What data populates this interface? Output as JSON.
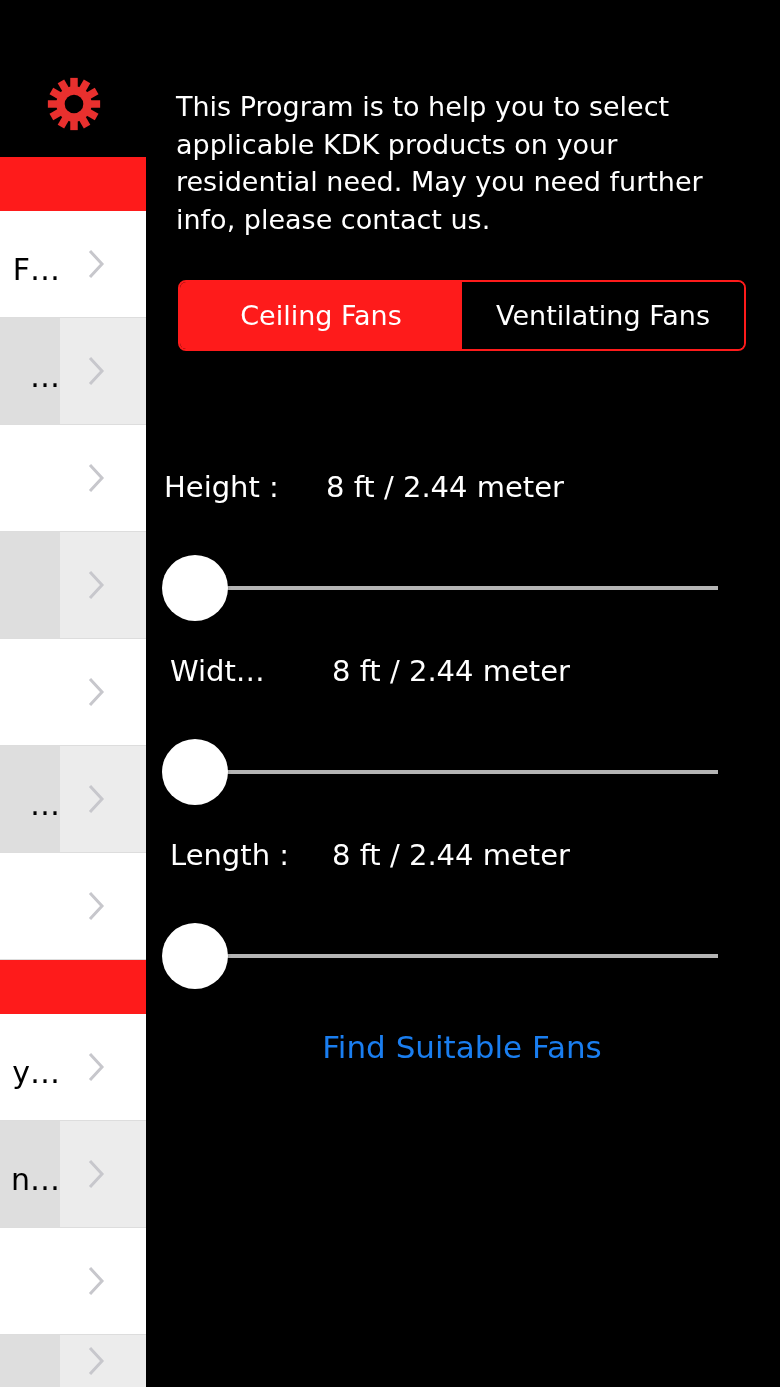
{
  "menu": {
    "items": [
      {
        "kind": "header"
      },
      {
        "kind": "row",
        "label": "F…"
      },
      {
        "kind": "row",
        "label": "…"
      },
      {
        "kind": "row"
      },
      {
        "kind": "row"
      },
      {
        "kind": "row"
      },
      {
        "kind": "row",
        "label": "…"
      },
      {
        "kind": "row"
      },
      {
        "kind": "header"
      },
      {
        "kind": "row",
        "label": "y…"
      },
      {
        "kind": "row",
        "label": "n…"
      },
      {
        "kind": "row"
      },
      {
        "kind": "row"
      }
    ]
  },
  "intro": "This Program is to help you to select applicable KDK products on your residential need. May you need further info, please contact us.",
  "tabs": [
    {
      "label": "Ceiling Fans",
      "selected": true
    },
    {
      "label": "Ventilating Fans",
      "selected": false
    }
  ],
  "sliders": [
    {
      "label": "Height :",
      "reading": "8 ft / 2.44 meter",
      "level": 0
    },
    {
      "label": "Widt…",
      "reading": "8 ft / 2.44 meter",
      "level": 0
    },
    {
      "label": "Length :",
      "reading": "8 ft / 2.44 meter",
      "level": 0
    }
  ],
  "action": "Find Suitable Fans"
}
